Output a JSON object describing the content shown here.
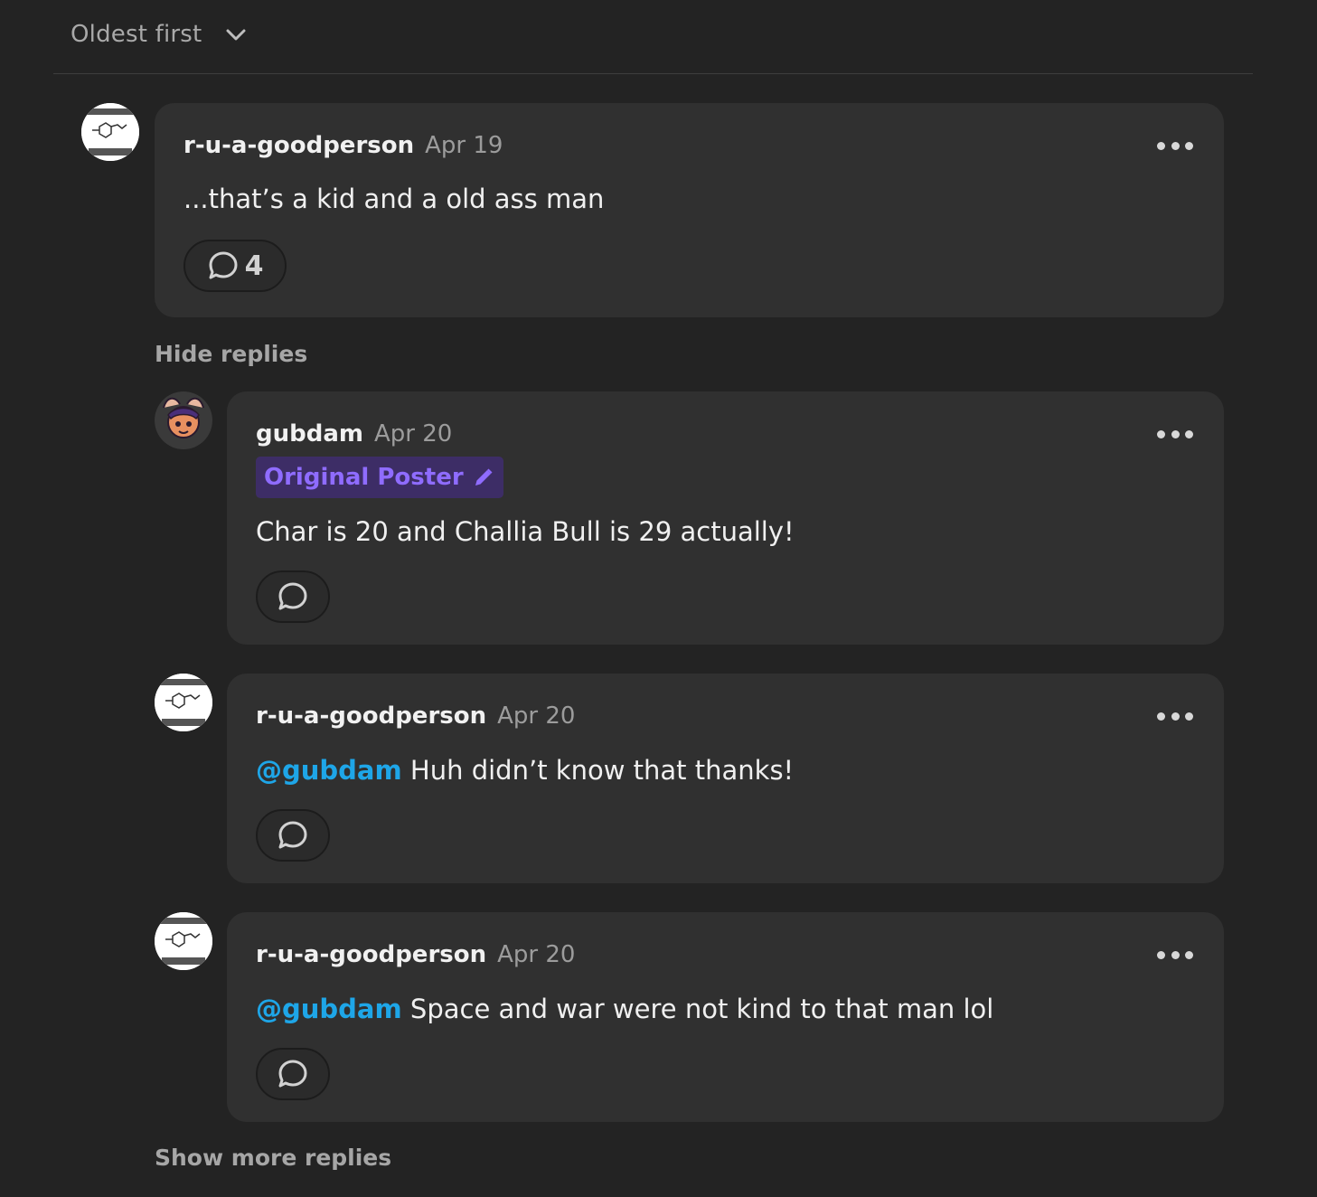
{
  "sort": {
    "label": "Oldest first",
    "chevron_icon": "chevron-down-icon"
  },
  "colors": {
    "background": "#232323",
    "card": "#303030",
    "mention": "#1ea6e8",
    "op_badge_text": "#8f6cff",
    "op_badge_bg": "#3d2d66"
  },
  "comments": [
    {
      "author": "r-u-a-goodperson",
      "date": "Apr 19",
      "text": "...that’s a kid and a old ass man",
      "reply_count": "4"
    }
  ],
  "hide_replies": "Hide replies",
  "replies": [
    {
      "author": "gubdam",
      "date": "Apr 20",
      "badge": "Original Poster",
      "text": "Char is 20 and Challia Bull is 29 actually!"
    },
    {
      "author": "r-u-a-goodperson",
      "date": "Apr 20",
      "mention": "@gubdam",
      "text": " Huh didn’t know that thanks!"
    },
    {
      "author": "r-u-a-goodperson",
      "date": "Apr 20",
      "mention": "@gubdam",
      "text": " Space and war were not kind to that man lol"
    }
  ],
  "show_more_replies": "Show more replies"
}
